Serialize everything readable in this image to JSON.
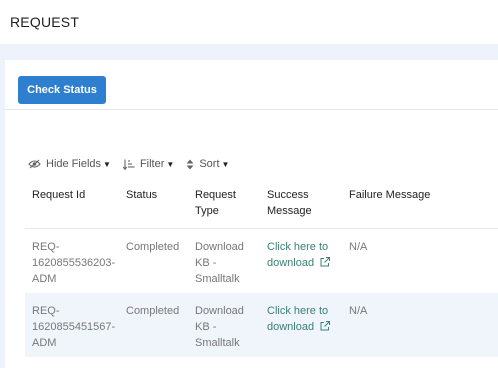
{
  "header": {
    "title": "REQUEST"
  },
  "actions": {
    "check_status_label": "Check Status"
  },
  "toolbar": {
    "hide_fields_label": "Hide Fields",
    "filter_label": "Filter",
    "sort_label": "Sort"
  },
  "table": {
    "columns": {
      "request_id": [
        "Request Id"
      ],
      "status": [
        "Status"
      ],
      "request_type": [
        "Request",
        "Type"
      ],
      "success_message": [
        "Success",
        "Message"
      ],
      "failure_message": [
        "Failure Message"
      ]
    },
    "rows": [
      {
        "request_id": [
          "REQ-",
          "1620855536203-",
          "ADM"
        ],
        "status": "Completed",
        "request_type": [
          "Download",
          "KB -",
          "Smalltalk"
        ],
        "success_message": [
          "Click here to",
          "download"
        ],
        "failure_message": "N/A"
      },
      {
        "request_id": [
          "REQ-",
          "1620855451567-",
          "ADM"
        ],
        "status": "Completed",
        "request_type": [
          "Download",
          "KB -",
          "Smalltalk"
        ],
        "success_message": [
          "Click here to",
          "download"
        ],
        "failure_message": "N/A"
      }
    ]
  },
  "colors": {
    "accent": "#2f7fd1",
    "link": "#3a7f73",
    "row_highlight": "#f0f5fc",
    "page_background": "#eef2fa"
  },
  "icons": {
    "hide_fields": "eye-slash-icon",
    "filter": "sort-amount-icon",
    "sort": "sort-arrows-icon",
    "caret": "caret-down-icon",
    "external": "external-link-icon"
  }
}
